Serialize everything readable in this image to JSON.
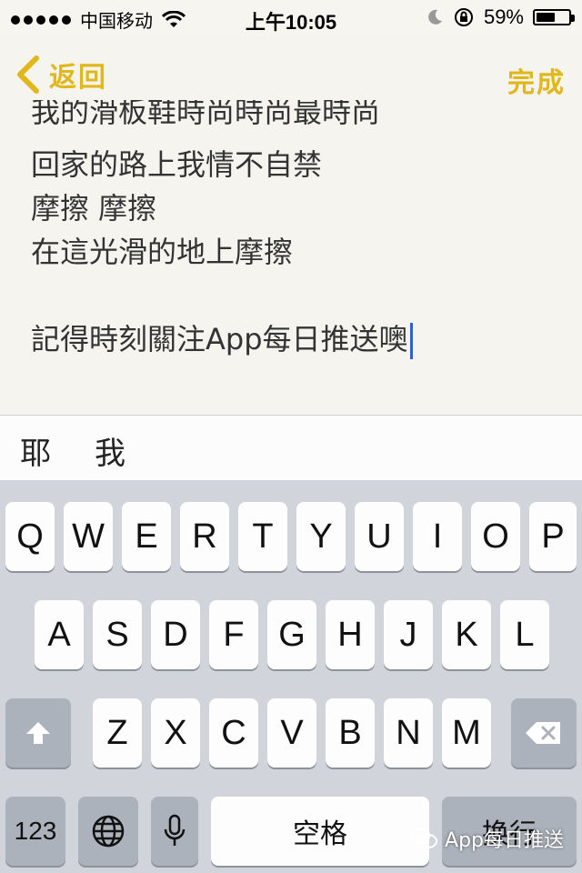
{
  "status_bar": {
    "carrier": "中国移动",
    "time": "上午10:05",
    "battery": "59%",
    "battery_level": 0.59,
    "icons": [
      "signal-dots",
      "wifi-icon",
      "moon-icon",
      "rotation-lock-icon",
      "battery-icon"
    ]
  },
  "nav": {
    "back_label": "返回",
    "done_label": "完成",
    "accent_color": "#e1b81c"
  },
  "note": {
    "lines": [
      "我的滑板鞋時尚時尚最時尚",
      "回家的路上我情不自禁",
      "摩擦 摩擦",
      "在這光滑的地上摩擦",
      "",
      "記得時刻關注App每日推送噢"
    ]
  },
  "candidates": [
    "耶",
    "我"
  ],
  "keyboard": {
    "row1": [
      "Q",
      "W",
      "E",
      "R",
      "T",
      "Y",
      "U",
      "I",
      "O",
      "P"
    ],
    "row2": [
      "A",
      "S",
      "D",
      "F",
      "G",
      "H",
      "J",
      "K",
      "L"
    ],
    "row3": [
      "Z",
      "X",
      "C",
      "V",
      "B",
      "N",
      "M"
    ],
    "numbers_key": "123",
    "space_key": "空格",
    "return_key": "换行",
    "icons": [
      "shift-icon",
      "delete-icon",
      "globe-icon",
      "microphone-icon"
    ]
  },
  "watermark": {
    "text": "App每日推送"
  }
}
